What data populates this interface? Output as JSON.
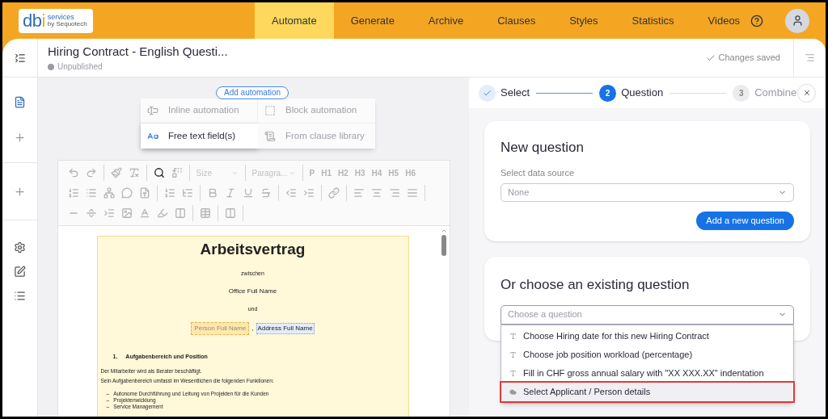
{
  "logo": {
    "letters": "db",
    "accent": "i",
    "line1": "services",
    "line2": "by Sequotech"
  },
  "nav": [
    {
      "label": "Automate",
      "selected": true
    },
    {
      "label": "Generate",
      "selected": false
    },
    {
      "label": "Archive",
      "selected": false
    },
    {
      "label": "Clauses",
      "selected": false
    },
    {
      "label": "Styles",
      "selected": false
    },
    {
      "label": "Statistics",
      "selected": false
    },
    {
      "label": "Videos",
      "selected": false
    }
  ],
  "document": {
    "title": "Hiring Contract - English Questi...",
    "status": "Unpublished",
    "save_state": "Changes saved"
  },
  "automation": {
    "button": "Add automation",
    "options": [
      {
        "label": "Inline automation",
        "kind": "inline",
        "selected": false
      },
      {
        "label": "Block automation",
        "kind": "block",
        "selected": false
      },
      {
        "label": "Free text field(s)",
        "kind": "text",
        "selected": true
      },
      {
        "label": "From clause library",
        "kind": "library",
        "selected": false
      }
    ]
  },
  "toolbar": {
    "size": "Size",
    "paragraph": "Paragra...",
    "headings": [
      "P",
      "H1",
      "H2",
      "H3",
      "H4",
      "H5",
      "H6"
    ]
  },
  "page": {
    "title": "Arbeitsvertrag",
    "between": "zwischen",
    "office": "Office Full Name",
    "and": "und",
    "person_field": "Person Full Name",
    "comma": ",",
    "address_field": "Address Full Name",
    "section_number": "1.",
    "section_title": "Aufgabenbereich und Position",
    "paragraph_1": "Der Mitarbeiter wird als Berater beschäftigt.",
    "paragraph_2": "Sein Aufgabenbereich umfasst im Wesentlichen die folgenden Funktionen:",
    "bullets": [
      {
        "marker": "–",
        "text": "Autonome Durchführung und Leitung von Projekten für die Kunden"
      },
      {
        "marker": "–",
        "text": "Projektenwicklung"
      },
      {
        "marker": "–",
        "text": "Service Management"
      }
    ]
  },
  "steps": [
    {
      "label": "Select",
      "completed": true,
      "selected": false
    },
    {
      "number": "2",
      "label": "Question",
      "completed": false,
      "selected": true
    },
    {
      "number": "3",
      "label": "Combine",
      "completed": false,
      "selected": false
    }
  ],
  "new_question": {
    "title": "New question",
    "field_label": "Select data source",
    "value": "None",
    "button": "Add a new question"
  },
  "existing_question": {
    "title": "Or choose an existing question",
    "placeholder": "Choose a question",
    "options": [
      {
        "kind": "text",
        "label": "Choose Hiring date for this new Hiring Contract",
        "selected": false
      },
      {
        "kind": "text",
        "label": "Choose job position workload (percentage)",
        "selected": false
      },
      {
        "kind": "text",
        "label": "Fill in CHF gross annual salary with \"XX XXX.XX\" indentation",
        "selected": false
      },
      {
        "kind": "entity",
        "label": "Select Applicant / Person details",
        "selected": true
      }
    ]
  }
}
